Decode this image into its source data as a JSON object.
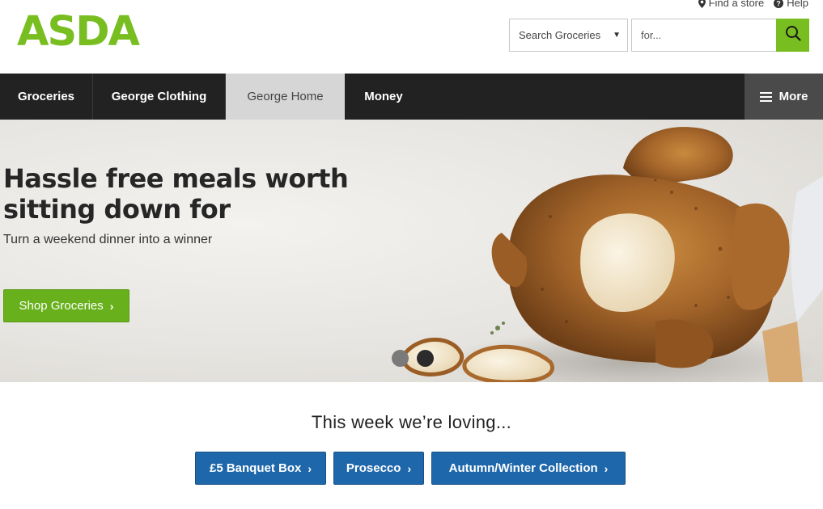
{
  "brand": {
    "logo_text": "ASDA",
    "accent": "#78be20"
  },
  "utility": {
    "find_store": "Find a store",
    "help": "Help"
  },
  "search": {
    "category_value": "Search Groceries",
    "placeholder": "for...",
    "button_icon": "search-icon"
  },
  "nav": {
    "items": [
      {
        "label": "Groceries"
      },
      {
        "label": "George Clothing"
      },
      {
        "label": "George Home",
        "active": true
      },
      {
        "label": "Money"
      }
    ],
    "more_label": "More"
  },
  "hero": {
    "title": "Hassle free meals worth sitting down for",
    "subtitle": "Turn a weekend dinner into a winner",
    "cta_label": "Shop Groceries",
    "slides": 2,
    "active_slide": 2
  },
  "loving": {
    "title": "This week we’re loving...",
    "tags": [
      {
        "label": "£5 Banquet Box"
      },
      {
        "label": "Prosecco"
      },
      {
        "label": "Autumn/Winter Collection"
      }
    ],
    "tag_color": "#1e67ab"
  }
}
